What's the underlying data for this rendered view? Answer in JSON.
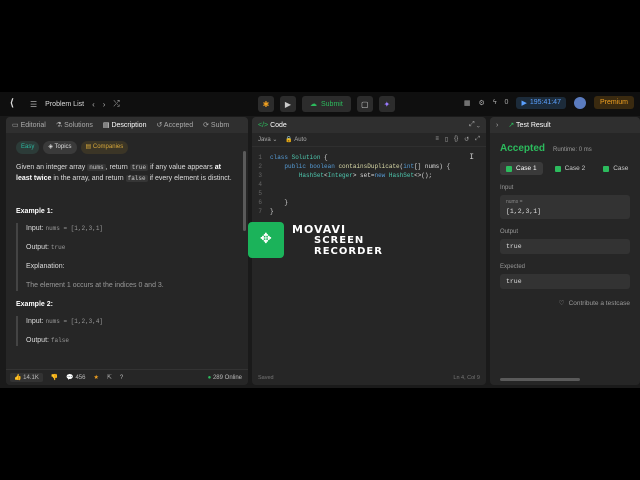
{
  "topbar": {
    "problem_list": "Problem List",
    "submit": "Submit",
    "timer": "195:41:47",
    "count": "0",
    "premium": "Premium"
  },
  "left": {
    "tabs": [
      "Editorial",
      "Solutions",
      "Description",
      "Accepted",
      "Subm"
    ],
    "tags": [
      "Easy",
      "Topics",
      "Companies"
    ],
    "desc_1": "Given an integer array ",
    "desc_code1": "nums",
    "desc_2": ", return ",
    "desc_code2": "true",
    "desc_3": " if any value appears ",
    "desc_bold": "at least twice",
    "desc_4": " in the array, and return ",
    "desc_code3": "false",
    "desc_5": " if every element is distinct.",
    "ex1_title": "Example 1:",
    "ex1_input_label": "Input:",
    "ex1_input": "nums = [1,2,3,1]",
    "ex1_output_label": "Output:",
    "ex1_output": "true",
    "ex1_expl_label": "Explanation:",
    "ex1_expl": "The element 1 occurs at the indices 0 and 3.",
    "ex2_title": "Example 2:",
    "ex2_input_label": "Input:",
    "ex2_input": "nums = [1,2,3,4]",
    "ex2_output_label": "Output:",
    "ex2_output": "false",
    "footer": {
      "likes": "14.1K",
      "comments": "456",
      "online": "289 Online"
    }
  },
  "code": {
    "title": "Code",
    "language": "Java",
    "auto": "Auto",
    "lines": [
      {
        "n": "1",
        "t": "class Solution {"
      },
      {
        "n": "2",
        "t": "    public boolean containsDuplicate(int[] nums) {"
      },
      {
        "n": "3",
        "t": "        HashSet<Integer> set=new HashSet<>();"
      },
      {
        "n": "4",
        "t": ""
      },
      {
        "n": "5",
        "t": ""
      },
      {
        "n": "6",
        "t": "    }"
      },
      {
        "n": "7",
        "t": "}"
      }
    ],
    "saved": "Saved",
    "position": "Ln 4, Col 9"
  },
  "result": {
    "title": "Test Result",
    "status": "Accepted",
    "runtime": "Runtime: 0 ms",
    "cases": [
      "Case 1",
      "Case 2",
      "Case"
    ],
    "input_label": "Input",
    "input_sub": "nums =",
    "input_value": "[1,2,3,1]",
    "output_label": "Output",
    "output_value": "true",
    "expected_label": "Expected",
    "expected_value": "true",
    "contribute": "Contribute a testcase"
  },
  "watermark": {
    "l1": "MOVAVI",
    "l2": "SCREEN",
    "l3": "RECORDER"
  },
  "colors": {
    "accent_green": "#2cbb5d",
    "accent_orange": "#f0a020",
    "accent_blue": "#5aa0ff"
  }
}
